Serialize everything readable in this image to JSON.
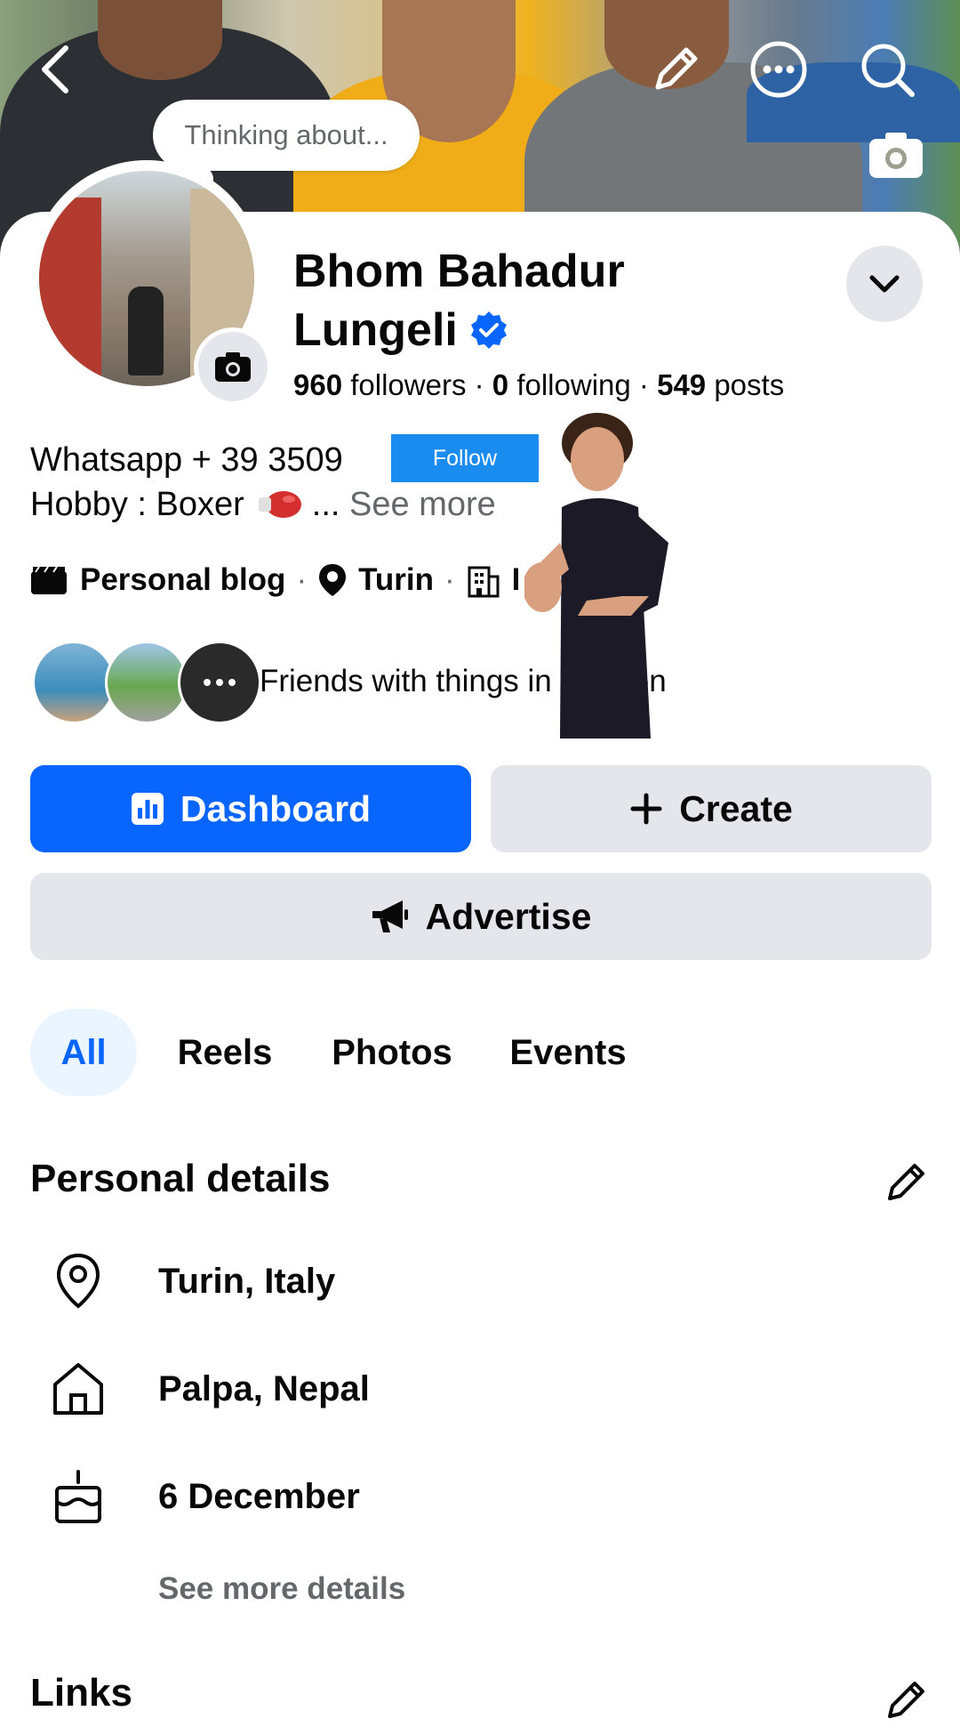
{
  "cover": {
    "thought_bubble": "Thinking about..."
  },
  "profile": {
    "name_line1": "Bhom Bahadur",
    "name_line2": "Lungeli",
    "followers_count": "960",
    "followers_label": "followers",
    "following_count": "0",
    "following_label": "following",
    "posts_count": "549",
    "posts_label": "posts",
    "bio_line1": "Whatsapp + 39 3509",
    "bio_line2": "Hobby : Boxer",
    "bio_ellipsis": "...",
    "see_more": "See more",
    "follow_label": "Follow",
    "meta_blog": "Personal blog",
    "meta_city": "Turin",
    "meta_work_partial": "I",
    "friends_text_a": "Friends with things in",
    "friends_text_b": "on"
  },
  "actions": {
    "dashboard": "Dashboard",
    "create": "Create",
    "advertise": "Advertise"
  },
  "tabs": [
    {
      "label": "All",
      "active": true
    },
    {
      "label": "Reels",
      "active": false
    },
    {
      "label": "Photos",
      "active": false
    },
    {
      "label": "Events",
      "active": false
    }
  ],
  "personal_details": {
    "title": "Personal details",
    "items": [
      {
        "icon": "location-pin-icon",
        "text": "Turin, Italy"
      },
      {
        "icon": "home-icon",
        "text": "Palpa, Nepal"
      },
      {
        "icon": "birthday-cake-icon",
        "text": "6 December"
      }
    ],
    "see_more": "See more details"
  },
  "links": {
    "title": "Links"
  },
  "colors": {
    "primary": "#0866ff",
    "secondary_bg": "#e4e6eb",
    "muted_text": "#65676b",
    "verified": "#0866ff",
    "follow_overlay": "#1a8cf0"
  }
}
